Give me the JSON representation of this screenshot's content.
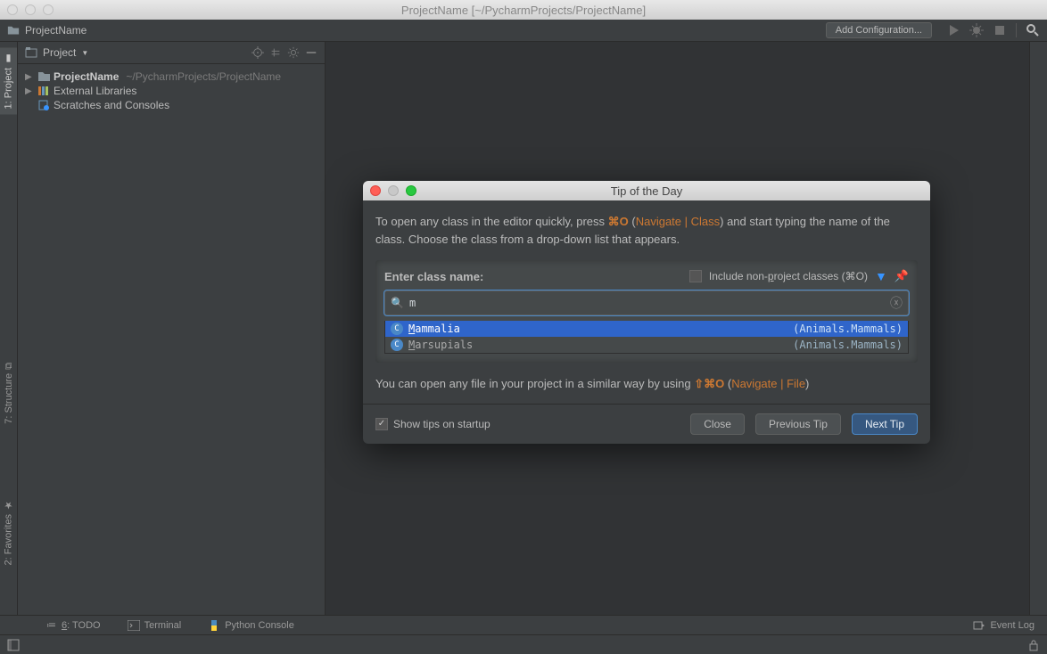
{
  "titlebar": {
    "title": "ProjectName [~/PycharmProjects/ProjectName]"
  },
  "breadcrumb": {
    "project_name": "ProjectName",
    "add_config": "Add Configuration..."
  },
  "project_panel": {
    "header": "Project",
    "tree": {
      "root": {
        "name": "ProjectName",
        "path": "~/PycharmProjects/ProjectName"
      },
      "ext_libs": "External Libraries",
      "scratches": "Scratches and Consoles"
    }
  },
  "left_rail": {
    "project": "1: Project",
    "structure": "7: Structure",
    "favorites": "2: Favorites"
  },
  "bottom_tabs": {
    "todo_underlined": "6",
    "todo_rest": ": TODO",
    "terminal": "Terminal",
    "python_console": "Python Console",
    "event_log": "Event Log"
  },
  "dialog": {
    "title": "Tip of the Day",
    "tip_line1_a": "To open any class in the editor quickly, press ",
    "tip_line1_kbd": "⌘O",
    "tip_line1_b": " (",
    "tip_line1_nav": "Navigate | Class",
    "tip_line1_c": ") and start typing the name of the class. Choose the class from a drop-down list that appears.",
    "search": {
      "label": "Enter class name:",
      "include_np_a": "Include non-",
      "include_np_u": "p",
      "include_np_b": "roject classes (⌘O)",
      "value": "m",
      "results": [
        {
          "prefix": "M",
          "rest": "ammalia",
          "pkg": "(Animals.Mammals)",
          "selected": true
        },
        {
          "prefix": "M",
          "rest": "arsupials",
          "pkg": "(Animals.Mammals)",
          "selected": false
        }
      ]
    },
    "tip_line2_a": "You can open any file in your project in a similar way by using ",
    "tip_line2_kbd": "⇧⌘O",
    "tip_line2_b": " (",
    "tip_line2_nav": "Navigate | File",
    "tip_line2_c": ")",
    "footer": {
      "show_tips": "Show tips on startup",
      "close": "Close",
      "prev": "Previous Tip",
      "next": "Next Tip"
    }
  }
}
